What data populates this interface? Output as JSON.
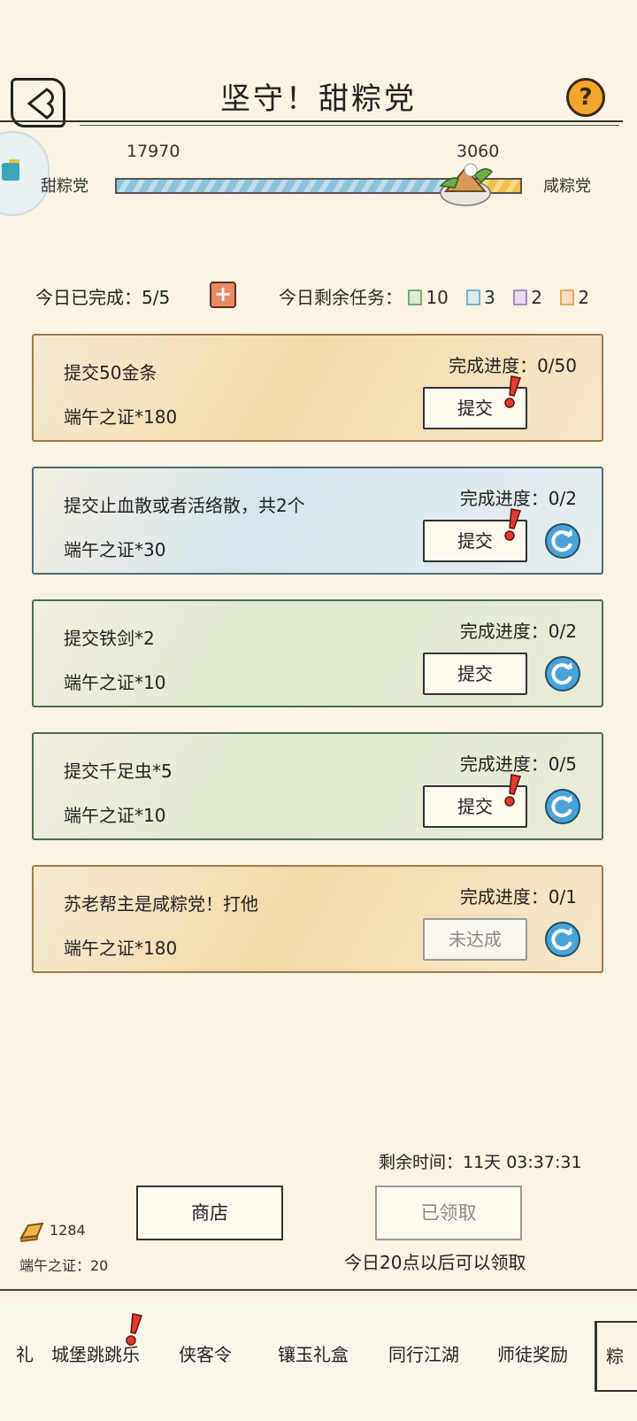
{
  "header": {
    "title": "坚守！甜粽党",
    "help_label": "?"
  },
  "vote": {
    "sweet_count": "17970",
    "salty_count": "3060",
    "sweet_label": "甜粽党",
    "salty_label": "咸粽党",
    "sweet_share": 0.855
  },
  "daily": {
    "completed_label": "今日已完成：5/5",
    "remaining_label": "今日剩余任务：",
    "remaining": [
      {
        "count": "10",
        "color": "#7bab6f"
      },
      {
        "count": "3",
        "color": "#7fb0c8"
      },
      {
        "count": "2",
        "color": "#a98ac4"
      },
      {
        "count": "2",
        "color": "#e2a867"
      }
    ]
  },
  "tasks": [
    {
      "name": "提交50金条",
      "reward": "端午之证*180",
      "progress": "完成进度：0/50",
      "button": "提交",
      "style": "orange",
      "alert": true,
      "refresh": false,
      "disabled": false
    },
    {
      "name": "提交止血散或者活络散，共2个",
      "reward": "端午之证*30",
      "progress": "完成进度：0/2",
      "button": "提交",
      "style": "blue",
      "alert": true,
      "refresh": true,
      "disabled": false
    },
    {
      "name": "提交铁剑*2",
      "reward": "端午之证*10",
      "progress": "完成进度：0/2",
      "button": "提交",
      "style": "green",
      "alert": false,
      "refresh": true,
      "disabled": false
    },
    {
      "name": "提交千足虫*5",
      "reward": "端午之证*10",
      "progress": "完成进度：0/5",
      "button": "提交",
      "style": "green",
      "alert": true,
      "refresh": true,
      "disabled": false
    },
    {
      "name": "苏老帮主是咸粽党！打他",
      "reward": "端午之证*180",
      "progress": "完成进度：0/1",
      "button": "未达成",
      "style": "orange",
      "alert": false,
      "refresh": true,
      "disabled": true
    }
  ],
  "footer": {
    "remain_time": "剩余时间：11天 03:37:31",
    "shop_label": "商店",
    "claim_label": "已领取",
    "gold_count": "1284",
    "cert_count": "端午之证：20",
    "claim_note": "今日20点以后可以领取"
  },
  "tabs": [
    "礼",
    "城堡跳跳乐",
    "侠客令",
    "镶玉礼盒",
    "同行江湖",
    "师徒奖励",
    "粽"
  ]
}
